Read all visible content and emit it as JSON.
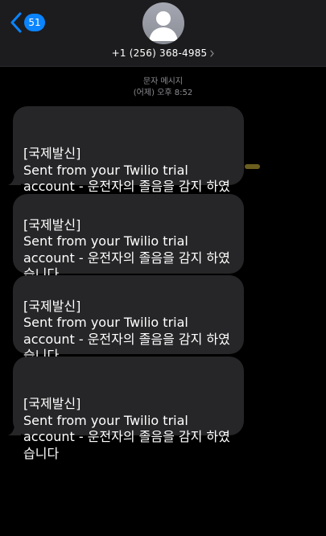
{
  "header": {
    "back_badge_count": "51",
    "contact_number": "+1 (256) 368-4985",
    "icons": {
      "back": "chevron-left-icon",
      "avatar": "person-silhouette-icon",
      "disclosure": "chevron-right-icon"
    },
    "colors": {
      "accent": "#0a84ff",
      "header_bg": "#1c1c1e"
    }
  },
  "conversation": {
    "service_label": "문자 메시지",
    "timestamp": "(어제) 오후 8:52",
    "messages": [
      {
        "text": "[국제발신]\nSent from your Twilio trial account - 운전자의 졸음을 감지 하였습니다"
      },
      {
        "text": "[국제발신]\nSent from your Twilio trial account - 운전자의 졸음을 감지 하였습니다"
      },
      {
        "text": "[국제발신]\nSent from your Twilio trial account - 운전자의 졸음을 감지 하였습니다"
      },
      {
        "text": "[국제발신]\nSent from your Twilio trial account - 운전자의 졸음을 감지 하였습니다"
      }
    ],
    "colors": {
      "incoming_bubble": "#262628",
      "background": "#000000",
      "meta_text": "#8e8e93"
    }
  }
}
